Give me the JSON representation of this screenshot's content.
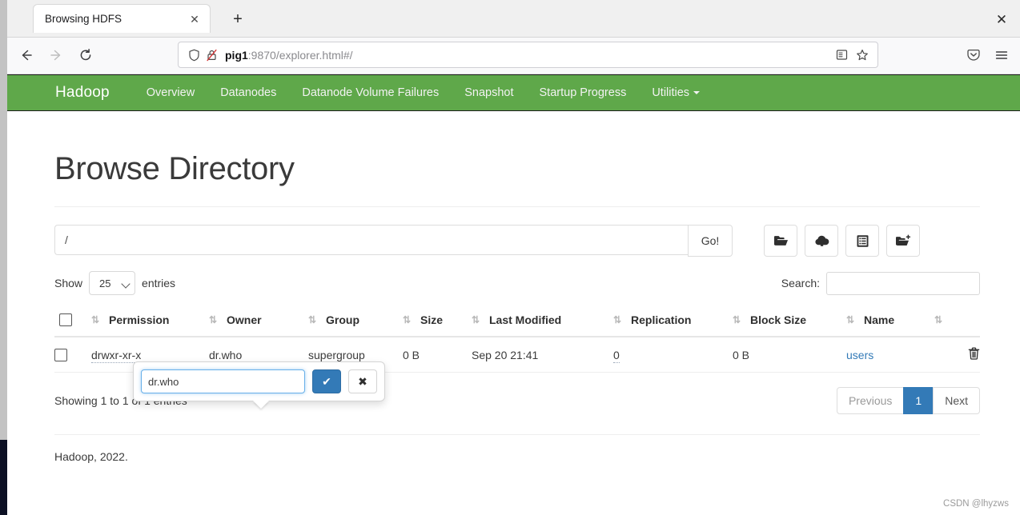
{
  "browser": {
    "tab": {
      "title": "Browsing HDFS",
      "close_label": "✕"
    },
    "new_tab_label": "+",
    "window_close_label": "✕",
    "url": {
      "host": "pig1",
      "rest": ":9870/explorer.html#/"
    },
    "icons": {
      "back": "back-arrow-icon",
      "forward": "forward-arrow-icon",
      "reload": "reload-icon",
      "shield": "shield-icon",
      "lock_broken": "broken-lock-icon",
      "reader": "reader-view-icon",
      "bookmark": "star-bookmark-icon",
      "pocket": "pocket-icon",
      "menu": "hamburger-menu-icon"
    }
  },
  "hadoop_nav": {
    "brand": "Hadoop",
    "links": [
      {
        "label": "Overview"
      },
      {
        "label": "Datanodes"
      },
      {
        "label": "Datanode Volume Failures"
      },
      {
        "label": "Snapshot"
      },
      {
        "label": "Startup Progress"
      },
      {
        "label": "Utilities",
        "caret": true
      }
    ],
    "bar_color": "#5fa84a"
  },
  "main": {
    "title": "Browse Directory",
    "path": {
      "value": "/",
      "placeholder": ""
    },
    "go_label": "Go!",
    "tool_icons": [
      {
        "name": "open-folder-icon"
      },
      {
        "name": "cloud-upload-icon"
      },
      {
        "name": "clipboard-list-icon"
      },
      {
        "name": "new-folder-icon"
      }
    ],
    "show_label": "Show",
    "entries_label": "entries",
    "page_length": "25",
    "search_label": "Search:",
    "search_value": "",
    "search_placeholder": "",
    "columns": [
      "Permission",
      "Owner",
      "Group",
      "Size",
      "Last Modified",
      "Replication",
      "Block Size",
      "Name"
    ],
    "rows": [
      {
        "permission": "drwxr-xr-x",
        "owner": "dr.who",
        "group": "supergroup",
        "size": "0 B",
        "last_modified": "Sep 20 21:41",
        "replication": "0",
        "block_size": "0 B",
        "name": "users",
        "delete_icon": "trash-icon"
      }
    ],
    "info_text": "Showing 1 to 1 of 1 entries",
    "pagination": {
      "previous": "Previous",
      "pages": [
        "1"
      ],
      "next": "Next",
      "active": "1",
      "active_color": "#337ab7"
    },
    "footer": "Hadoop, 2022."
  },
  "popover": {
    "input_value": "dr.who",
    "input_placeholder": "",
    "confirm_label": "✔",
    "cancel_label": "✖",
    "confirm_color": "#337ab7"
  },
  "watermark": "CSDN @lhyzws"
}
